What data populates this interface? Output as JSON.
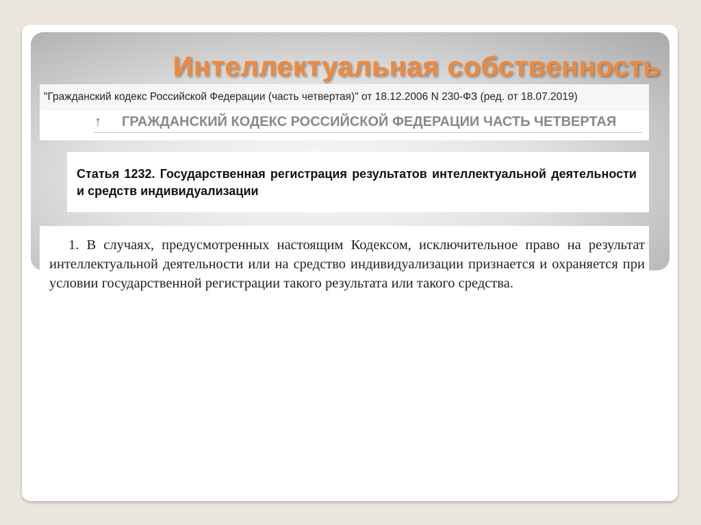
{
  "slide": {
    "title": "Интеллектуальная собственность",
    "citation": "\"Гражданский кодекс Российской Федерации (часть четвертая)\" от 18.12.2006 N 230-ФЗ (ред. от 18.07.2019)",
    "up_arrow": "↑",
    "code_header": "ГРАЖДАНСКИЙ КОДЕКС РОССИЙСКОЙ ФЕДЕРАЦИИ ЧАСТЬ ЧЕТВЕРТАЯ",
    "article_title": "Статья 1232. Государственная регистрация результатов интеллектуальной деятельности и средств индивидуализации",
    "paragraph": "1. В случаях, предусмотренных настоящим Кодексом, исключительное право на результат интеллектуальной деятельности или на средство индивидуализации признается и охраняется при условии государственной регистрации такого результата или такого средства."
  },
  "colors": {
    "title": "#f0893a",
    "background": "#ebe7df"
  }
}
